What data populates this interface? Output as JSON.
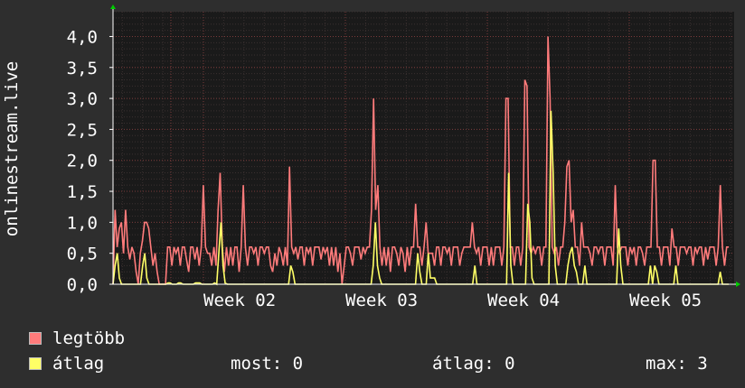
{
  "chart_data": {
    "type": "line",
    "ylabel": "onlinestream.live",
    "ylim": [
      0,
      4.4
    ],
    "y_ticks": [
      "0,0",
      "0,5",
      "1,0",
      "1,5",
      "2,0",
      "2,5",
      "3,0",
      "3,5",
      "4,0"
    ],
    "y_tick_values": [
      0,
      0.5,
      1.0,
      1.5,
      2.0,
      2.5,
      3.0,
      3.5,
      4.0
    ],
    "x_ticks": [
      "Week 02",
      "Week 03",
      "Week 04",
      "Week 05"
    ],
    "grid": true,
    "series": [
      {
        "name": "legtöbb",
        "color": "#ff7b7b",
        "values": [
          0,
          1.2,
          0.6,
          0.9,
          1.0,
          0.5,
          1.2,
          0.6,
          0.4,
          0.6,
          0.5,
          0.2,
          0,
          0.5,
          0.7,
          1.0,
          1.0,
          0.9,
          0.6,
          0.3,
          0.5,
          0.2,
          0,
          0,
          0,
          0,
          0.6,
          0.6,
          0.3,
          0.6,
          0.5,
          0.6,
          0.3,
          0.6,
          0.6,
          0.4,
          0.2,
          0.6,
          0.6,
          0.4,
          0.6,
          0.3,
          0.6,
          1.6,
          0.6,
          0.5,
          0.5,
          0.3,
          0.6,
          0.3,
          1.2,
          1.8,
          0.6,
          0.2,
          0.6,
          0.3,
          0.6,
          0.3,
          0.6,
          0.6,
          0.2,
          0.6,
          1.6,
          0.6,
          0.3,
          0.6,
          0.6,
          0.5,
          0.6,
          0.3,
          0.6,
          0.6,
          0.5,
          0.6,
          0.6,
          0.3,
          0.2,
          0.5,
          0.3,
          0.6,
          0.5,
          0.3,
          0.6,
          0.3,
          1.9,
          0.6,
          0.5,
          0.6,
          0.4,
          0.6,
          0.6,
          0.3,
          0.6,
          0.5,
          0.6,
          0.3,
          0.6,
          0.6,
          0.6,
          0.4,
          0.6,
          0.5,
          0.6,
          0.3,
          0.6,
          0.3,
          0.6,
          0.2,
          0.5,
          0,
          0.3,
          0.6,
          0.6,
          0.5,
          0.3,
          0.6,
          0.6,
          0.6,
          0.4,
          0.6,
          0.5,
          0.6,
          0.6,
          1.2,
          3.0,
          1.2,
          1.6,
          0.6,
          0.3,
          0.6,
          0.3,
          0.6,
          0.2,
          0.6,
          0.6,
          0.5,
          0.3,
          0.6,
          0.5,
          0.2,
          0.6,
          0.3,
          0.6,
          0.6,
          1.3,
          0.6,
          0.6,
          0.3,
          0.6,
          1.0,
          0.5,
          0.5,
          0.5,
          0.3,
          0.6,
          0.6,
          0.3,
          0.6,
          0.6,
          0.5,
          0.6,
          0.3,
          0.6,
          0.6,
          0.6,
          0.3,
          0.5,
          0.6,
          0.6,
          0.6,
          0.6,
          1.0,
          0.6,
          0.5,
          0.6,
          0.3,
          0.6,
          0.6,
          0.6,
          0.3,
          0.6,
          0.3,
          0.6,
          0.6,
          0.6,
          0.3,
          0.6,
          3.0,
          3.0,
          0.6,
          0.6,
          0.3,
          0.6,
          0.6,
          0.3,
          0.6,
          3.3,
          3.2,
          0.6,
          0.5,
          0.6,
          0.5,
          0.6,
          0.6,
          0.3,
          0.6,
          0.6,
          4.0,
          3.0,
          0.6,
          0.5,
          0.6,
          0.3,
          0.6,
          0.6,
          1.0,
          1.9,
          2.0,
          1.0,
          1.2,
          0.6,
          0.6,
          0.3,
          1.0,
          0.6,
          0.6,
          0.6,
          0.5,
          0.3,
          0.6,
          0.6,
          0.5,
          0.6,
          0.6,
          0.3,
          0.6,
          0.6,
          0.6,
          0.3,
          1.6,
          0.6,
          0.5,
          0.6,
          0.6,
          0.6,
          0.3,
          0.6,
          0.5,
          0.6,
          0.3,
          0.6,
          0.6,
          0.5,
          0.3,
          0.6,
          0.6,
          0.6,
          2.0,
          2.0,
          0.6,
          0.6,
          0.3,
          0.6,
          0.6,
          0.6,
          0.3,
          0.9,
          0.6,
          0.6,
          0.3,
          0.6,
          0.6,
          0.6,
          0.5,
          0.6,
          0.6,
          0.3,
          0.6,
          0.5,
          0.6,
          0.6,
          0.3,
          0.6,
          0.4,
          0.6,
          0.6,
          0.6,
          0.3,
          0.6,
          1.6,
          0.6,
          0.3,
          0.6,
          0.6
        ]
      },
      {
        "name": "átlag",
        "color": "#ffff66",
        "values": [
          0,
          0.3,
          0.5,
          0.1,
          0,
          0,
          0,
          0,
          0,
          0,
          0,
          0,
          0,
          0,
          0.3,
          0.5,
          0.1,
          0,
          0,
          0,
          0,
          0,
          0,
          0,
          0,
          0,
          0.02,
          0.02,
          0,
          0,
          0,
          0.02,
          0.02,
          0,
          0,
          0,
          0,
          0,
          0,
          0.02,
          0.02,
          0.02,
          0,
          0,
          0,
          0,
          0,
          0,
          0.02,
          0,
          0.5,
          1.0,
          0.3,
          0.02,
          0,
          0,
          0,
          0,
          0,
          0,
          0,
          0,
          0,
          0,
          0,
          0,
          0,
          0,
          0,
          0,
          0,
          0,
          0,
          0,
          0,
          0,
          0,
          0,
          0,
          0,
          0,
          0,
          0,
          0,
          0.3,
          0.2,
          0,
          0,
          0,
          0,
          0,
          0,
          0,
          0,
          0,
          0,
          0,
          0,
          0,
          0,
          0,
          0,
          0,
          0,
          0,
          0,
          0,
          0,
          0,
          0,
          0,
          0,
          0,
          0,
          0,
          0,
          0,
          0,
          0,
          0,
          0,
          0,
          0,
          0.3,
          1.0,
          0.3,
          0.1,
          0,
          0,
          0,
          0,
          0,
          0,
          0,
          0,
          0,
          0,
          0,
          0,
          0,
          0,
          0,
          0,
          0,
          0.5,
          0.2,
          0,
          0,
          0,
          0.5,
          0.1,
          0.1,
          0.1,
          0,
          0,
          0,
          0,
          0,
          0,
          0,
          0,
          0,
          0,
          0,
          0,
          0,
          0,
          0,
          0,
          0,
          0,
          0.3,
          0,
          0,
          0,
          0,
          0,
          0,
          0,
          0,
          0,
          0,
          0,
          0,
          0,
          0,
          0,
          1.8,
          0.3,
          0,
          0,
          0,
          0,
          0,
          0,
          0,
          1.3,
          1.0,
          0.1,
          0,
          0,
          0,
          0,
          0,
          0,
          0,
          0,
          2.8,
          1.8,
          0.3,
          0,
          0,
          0,
          0,
          0,
          0.3,
          0.5,
          0.6,
          0.3,
          0.2,
          0,
          0,
          0,
          0.3,
          0,
          0,
          0,
          0,
          0,
          0,
          0,
          0,
          0,
          0,
          0,
          0,
          0,
          0,
          0,
          0.9,
          0.3,
          0,
          0,
          0,
          0,
          0,
          0,
          0,
          0,
          0,
          0,
          0,
          0,
          0,
          0.3,
          0,
          0.3,
          0.2,
          0,
          0,
          0,
          0,
          0,
          0,
          0,
          0,
          0.3,
          0,
          0,
          0,
          0,
          0,
          0,
          0,
          0,
          0,
          0,
          0,
          0,
          0,
          0,
          0,
          0,
          0,
          0,
          0,
          0,
          0.2,
          0,
          0,
          0,
          0
        ]
      }
    ]
  },
  "legend": [
    {
      "label": "legtöbb",
      "color": "#ff7b7b"
    },
    {
      "label": "átlag",
      "color": "#ffff66"
    }
  ],
  "stats": {
    "most": "most: 0",
    "atlag": "átlag: 0",
    "max": "max: 3"
  }
}
